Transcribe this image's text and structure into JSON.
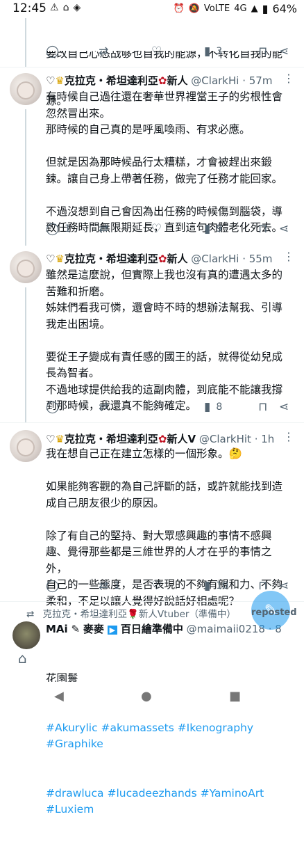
{
  "status_bar": {
    "time": "12:45",
    "battery": "64%",
    "network": "4G"
  },
  "top_tweet": {
    "text_line1": "要改自己心态战够也自我的能源，不转化自我的能",
    "text_line2": "源。",
    "views": "3"
  },
  "tweets": [
    {
      "author": "克拉克・希坦達利亞",
      "suffix": "新人",
      "handle": "@ClarkHi",
      "time": "· 57m",
      "body": "有時候自己過往還在奢華世界裡當王子的劣根性會忽然冒出來。\n那時候的自己真的是呼風喚雨、有求必應。\n\n但就是因為那時候品行太糟糕，才會被趕出來鍛鍊。讓自己身上帶著任務，做完了任務才能回家。\n\n不過沒想到自己會因為出任務的時候傷到腦袋，導致任務時間無限期延長，直到這句肉體老化死去。",
      "replies": "1",
      "retweets": "",
      "likes": "",
      "views": "9"
    },
    {
      "author": "克拉克・希坦達利亞",
      "suffix": "新人",
      "handle": "@ClarkHi",
      "time": "· 55m",
      "body": "雖然是這麼說，但實際上我也沒有真的遭遇太多的苦難和折磨。\n姊妹們看我可憐，還會時不時的想辦法幫我、引導我走出困境。\n\n要從王子變成有責任感的國王的話，就得從幼兒成長為智者。\n不過地球提供給我的這副肉體，到底能不能讓我撐到那時候，我還真不能夠確定。",
      "replies": "",
      "retweets": "",
      "likes": "",
      "views": "8"
    },
    {
      "author": "克拉克・希坦達利亞",
      "suffix": "新人V",
      "handle": "@ClarkHit",
      "time": "· 1h",
      "body": "我在想自己正在建立怎樣的一個形象。🤔\n\n如果能夠客觀的為自己評斷的話，或許就能找到造成自己朋友很少的原因。\n\n除了有自己的堅持、對大眾感興趣的事情不感興趣、覺得那些都是三維世界的人才在乎的事情之外，\n自己的一些態度，是否表現的不夠有親和力、不夠柔和，不足以讓人覺得好說話好相處呢？",
      "replies": "",
      "retweets": "1",
      "likes": "",
      "views": "10"
    }
  ],
  "repost": {
    "reposter": "克拉克・希坦達利亞🌹新人Vtuber（準備中）",
    "label": "reposted",
    "author": "MAi",
    "author_extra": "麥麥",
    "author_tag": "百日繪準備中",
    "handle": "@maimaii0218",
    "time": "· 8h",
    "body_line1": "花園鬟",
    "hashtags_line1": "#Akurylic #akumassets #Ikenography #Graphike",
    "hashtags_line2": "#drawluca #lucadeezhands #YaminoArt #Luxiem"
  },
  "colors": {
    "accent": "#1d9bf0",
    "muted": "#536471"
  }
}
